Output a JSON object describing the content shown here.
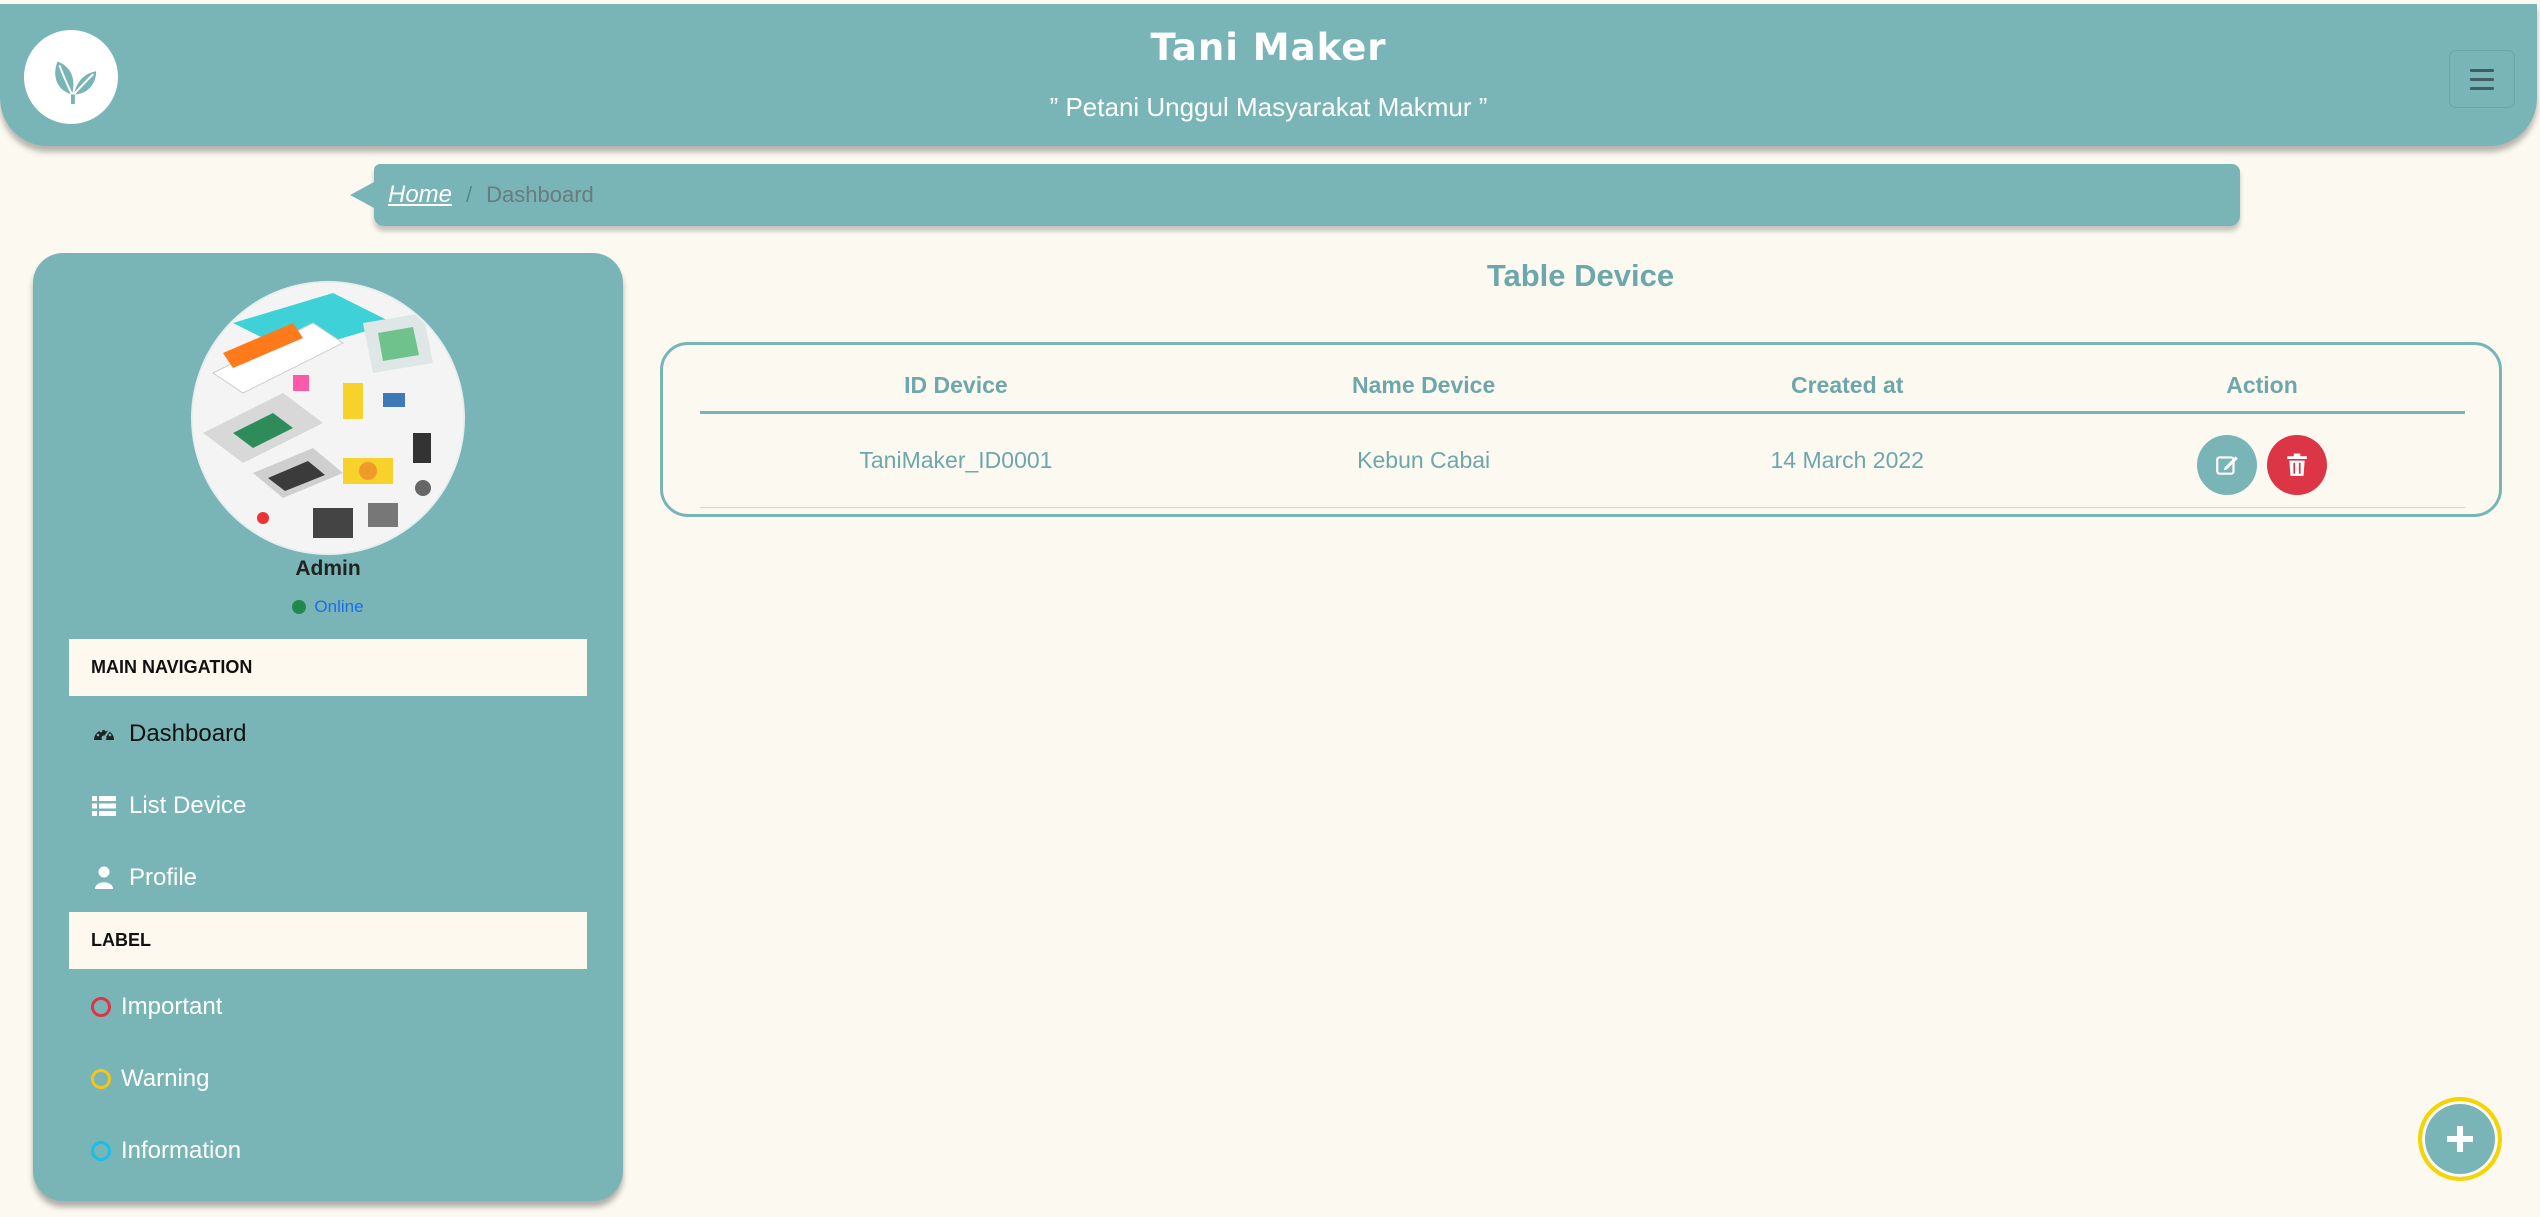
{
  "header": {
    "title": "Tani Maker",
    "tagline": "” Petani Unggul Masyarakat Makmur ”",
    "logo_icon": "leaf-icon",
    "menu_icon": "hamburger-icon"
  },
  "breadcrumb": {
    "home": "Home",
    "separator": "/",
    "current": "Dashboard"
  },
  "sidebar": {
    "user_name": "Admin",
    "status": "Online",
    "nav_header": "MAIN NAVIGATION",
    "nav_items": [
      {
        "label": "Dashboard",
        "icon": "dashboard-icon"
      },
      {
        "label": "List Device",
        "icon": "list-icon"
      },
      {
        "label": "Profile",
        "icon": "user-icon"
      }
    ],
    "label_header": "LABEL",
    "labels": [
      {
        "label": "Important",
        "color": "#dc3545"
      },
      {
        "label": "Warning",
        "color": "#f5c518"
      },
      {
        "label": "Information",
        "color": "#17c0e8"
      }
    ]
  },
  "main": {
    "title": "Table Device",
    "columns": [
      "ID Device",
      "Name Device",
      "Created at",
      "Action"
    ],
    "rows": [
      {
        "id": "TaniMaker_ID0001",
        "name": "Kebun Cabai",
        "created": "14 March 2022"
      }
    ]
  },
  "colors": {
    "primary": "#79b5b7",
    "background": "#fcf9f0",
    "danger": "#dc3545",
    "fab_ring": "#f5d400"
  }
}
